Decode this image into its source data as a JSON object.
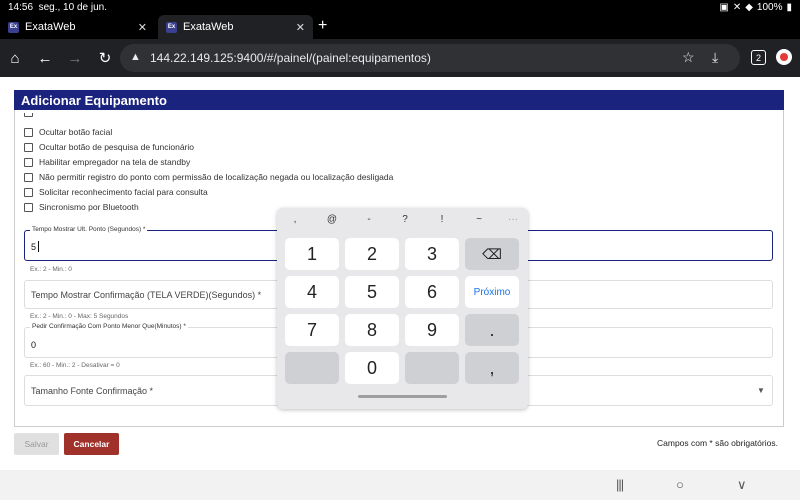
{
  "status": {
    "time": "14:56",
    "date": "seg., 10 de jun.",
    "battery": "100%"
  },
  "tabs": [
    {
      "favicon": "Ex",
      "title": "ExataWeb",
      "close": "✕"
    },
    {
      "favicon": "Ex",
      "title": "ExataWeb",
      "close": "✕"
    }
  ],
  "newtab": "+",
  "toolbar": {
    "url": "144.22.149.125:9400/#/painel/(painel:equipamentos)",
    "tab_count": "2"
  },
  "page": {
    "header": "Adicionar Equipamento",
    "checkboxes": [
      "Ocultar botão facial",
      "Ocultar botão de pesquisa de funcionário",
      "Habilitar empregador na tela de standby",
      "Não permitir registro do ponto com permissão de localização negada ou localização desligada",
      "Solicitar reconhecimento facial para consulta",
      "Sincronismo por Bluetooth"
    ],
    "fields": {
      "tempo_ult_ponto": {
        "label": "Tempo Mostrar Ult. Ponto (Segundos) *",
        "value": "5",
        "hint": "Ex.: 2 - Min.: 0"
      },
      "tempo_confirmacao": {
        "placeholder": "Tempo Mostrar Confirmação (TELA VERDE)(Segundos) *",
        "hint": "Ex.: 2 - Min.: 0 - Max: 5 Segundos"
      },
      "pedir_confirmacao": {
        "label": "Pedir Confirmação Com Ponto Menor Que(Minutos) *",
        "value": "0",
        "hint": "Ex.: 60 - Min.: 2 - Desativar = 0"
      },
      "tamanho_fonte": {
        "placeholder": "Tamanho Fonte Confirmação *"
      }
    },
    "buttons": {
      "save": "Salvar",
      "cancel": "Cancelar"
    },
    "required_note": "Campos com * são obrigatórios."
  },
  "keyboard": {
    "symbols": [
      ",",
      "@",
      "-",
      "?",
      "!",
      "~",
      "···"
    ],
    "keys": [
      "1",
      "2",
      "3",
      "4",
      "5",
      "6",
      "7",
      "8",
      "9",
      "0"
    ],
    "next": "Próximo",
    "dot": ".",
    "comma": ","
  },
  "nav": {
    "recents": "|||",
    "home": "○",
    "back": "∨"
  }
}
